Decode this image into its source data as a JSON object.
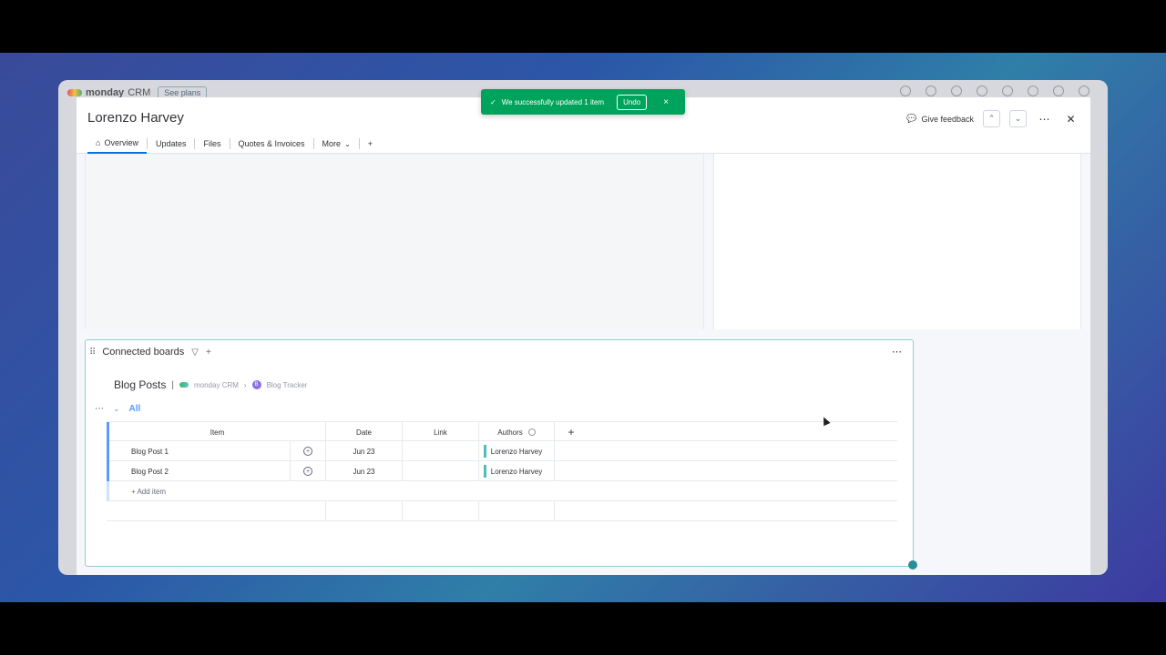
{
  "app": {
    "brand": "monday",
    "product": "CRM",
    "see_plans": "See plans"
  },
  "modal": {
    "title": "Lorenzo Harvey",
    "tabs": [
      {
        "label": "Overview",
        "icon": "home-icon"
      },
      {
        "label": "Updates"
      },
      {
        "label": "Files"
      },
      {
        "label": "Quotes & Invoices"
      },
      {
        "label": "More",
        "icon": "chevron-down-icon"
      },
      {
        "label": "+"
      }
    ],
    "give_feedback": "Give feedback"
  },
  "toast": {
    "message": "We successfully updated 1 item",
    "undo": "Undo",
    "close": "×",
    "color": "#00a35c"
  },
  "connected_boards": {
    "title": "Connected boards",
    "board": {
      "name": "Blog Posts",
      "workspace": "monday CRM",
      "board_ref": "Blog Tracker"
    },
    "group": {
      "name": "All",
      "color": "#579bfc"
    },
    "columns": [
      "Item",
      "Date",
      "Link",
      "Authors"
    ],
    "rows": [
      {
        "item": "Blog Post 1",
        "date": "Jun 23",
        "link": "",
        "authors": "Lorenzo Harvey"
      },
      {
        "item": "Blog Post 2",
        "date": "Jun 23",
        "link": "",
        "authors": "Lorenzo Harvey"
      }
    ],
    "add_item": "+ Add item"
  }
}
